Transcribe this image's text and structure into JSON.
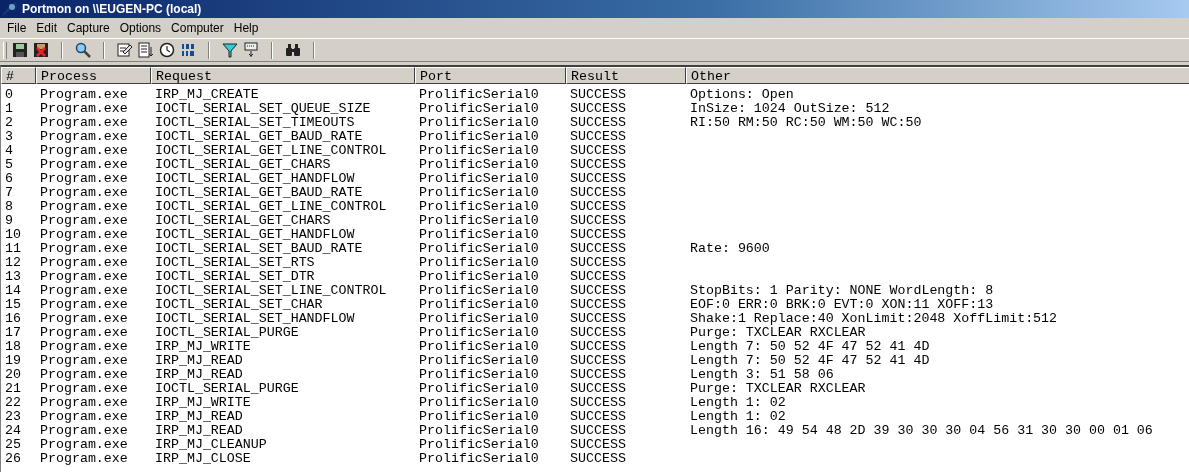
{
  "window": {
    "title": "Portmon on \\\\EUGEN-PC (local)"
  },
  "menu": [
    "File",
    "Edit",
    "Capture",
    "Options",
    "Computer",
    "Help"
  ],
  "table": {
    "columns": [
      "#",
      "Process",
      "Request",
      "Port",
      "Result",
      "Other"
    ],
    "rows": [
      {
        "num": "0",
        "process": "Program.exe",
        "request": "IRP_MJ_CREATE",
        "port": "ProlificSerial0",
        "result": "SUCCESS",
        "other": "Options: Open"
      },
      {
        "num": "1",
        "process": "Program.exe",
        "request": "IOCTL_SERIAL_SET_QUEUE_SIZE",
        "port": "ProlificSerial0",
        "result": "SUCCESS",
        "other": "InSize: 1024 OutSize: 512"
      },
      {
        "num": "2",
        "process": "Program.exe",
        "request": "IOCTL_SERIAL_SET_TIMEOUTS",
        "port": "ProlificSerial0",
        "result": "SUCCESS",
        "other": "RI:50 RM:50 RC:50 WM:50 WC:50"
      },
      {
        "num": "3",
        "process": "Program.exe",
        "request": "IOCTL_SERIAL_GET_BAUD_RATE",
        "port": "ProlificSerial0",
        "result": "SUCCESS"
      },
      {
        "num": "4",
        "process": "Program.exe",
        "request": "IOCTL_SERIAL_GET_LINE_CONTROL",
        "port": "ProlificSerial0",
        "result": "SUCCESS"
      },
      {
        "num": "5",
        "process": "Program.exe",
        "request": "IOCTL_SERIAL_GET_CHARS",
        "port": "ProlificSerial0",
        "result": "SUCCESS"
      },
      {
        "num": "6",
        "process": "Program.exe",
        "request": "IOCTL_SERIAL_GET_HANDFLOW",
        "port": "ProlificSerial0",
        "result": "SUCCESS"
      },
      {
        "num": "7",
        "process": "Program.exe",
        "request": "IOCTL_SERIAL_GET_BAUD_RATE",
        "port": "ProlificSerial0",
        "result": "SUCCESS"
      },
      {
        "num": "8",
        "process": "Program.exe",
        "request": "IOCTL_SERIAL_GET_LINE_CONTROL",
        "port": "ProlificSerial0",
        "result": "SUCCESS"
      },
      {
        "num": "9",
        "process": "Program.exe",
        "request": "IOCTL_SERIAL_GET_CHARS",
        "port": "ProlificSerial0",
        "result": "SUCCESS"
      },
      {
        "num": "10",
        "process": "Program.exe",
        "request": "IOCTL_SERIAL_GET_HANDFLOW",
        "port": "ProlificSerial0",
        "result": "SUCCESS"
      },
      {
        "num": "11",
        "process": "Program.exe",
        "request": "IOCTL_SERIAL_SET_BAUD_RATE",
        "port": "ProlificSerial0",
        "result": "SUCCESS",
        "other": "Rate: 9600"
      },
      {
        "num": "12",
        "process": "Program.exe",
        "request": "IOCTL_SERIAL_SET_RTS",
        "port": "ProlificSerial0",
        "result": "SUCCESS"
      },
      {
        "num": "13",
        "process": "Program.exe",
        "request": "IOCTL_SERIAL_SET_DTR",
        "port": "ProlificSerial0",
        "result": "SUCCESS"
      },
      {
        "num": "14",
        "process": "Program.exe",
        "request": "IOCTL_SERIAL_SET_LINE_CONTROL",
        "port": "ProlificSerial0",
        "result": "SUCCESS",
        "other": "StopBits: 1 Parity: NONE WordLength: 8"
      },
      {
        "num": "15",
        "process": "Program.exe",
        "request": "IOCTL_SERIAL_SET_CHAR",
        "port": "ProlificSerial0",
        "result": "SUCCESS",
        "other": "EOF:0 ERR:0 BRK:0 EVT:0 XON:11 XOFF:13"
      },
      {
        "num": "16",
        "process": "Program.exe",
        "request": "IOCTL_SERIAL_SET_HANDFLOW",
        "port": "ProlificSerial0",
        "result": "SUCCESS",
        "other": "Shake:1 Replace:40 XonLimit:2048 XoffLimit:512"
      },
      {
        "num": "17",
        "process": "Program.exe",
        "request": "IOCTL_SERIAL_PURGE",
        "port": "ProlificSerial0",
        "result": "SUCCESS",
        "other": "Purge: TXCLEAR RXCLEAR"
      },
      {
        "num": "18",
        "process": "Program.exe",
        "request": "IRP_MJ_WRITE",
        "port": "ProlificSerial0",
        "result": "SUCCESS",
        "other": "Length 7: 50 52 4F 47 52 41 4D"
      },
      {
        "num": "19",
        "process": "Program.exe",
        "request": "IRP_MJ_READ",
        "port": "ProlificSerial0",
        "result": "SUCCESS",
        "other": "Length 7: 50 52 4F 47 52 41 4D"
      },
      {
        "num": "20",
        "process": "Program.exe",
        "request": "IRP_MJ_READ",
        "port": "ProlificSerial0",
        "result": "SUCCESS",
        "other": "Length 3: 51 58 06"
      },
      {
        "num": "21",
        "process": "Program.exe",
        "request": "IOCTL_SERIAL_PURGE",
        "port": "ProlificSerial0",
        "result": "SUCCESS",
        "other": "Purge: TXCLEAR RXCLEAR"
      },
      {
        "num": "22",
        "process": "Program.exe",
        "request": "IRP_MJ_WRITE",
        "port": "ProlificSerial0",
        "result": "SUCCESS",
        "other": "Length 1: 02"
      },
      {
        "num": "23",
        "process": "Program.exe",
        "request": "IRP_MJ_READ",
        "port": "ProlificSerial0",
        "result": "SUCCESS",
        "other": "Length 1: 02"
      },
      {
        "num": "24",
        "process": "Program.exe",
        "request": "IRP_MJ_READ",
        "port": "ProlificSerial0",
        "result": "SUCCESS",
        "other": "Length 16: 49 54 48 2D 39 30 30 30 04 56 31 30 30 00 01 06"
      },
      {
        "num": "25",
        "process": "Program.exe",
        "request": "IRP_MJ_CLEANUP",
        "port": "ProlificSerial0",
        "result": "SUCCESS"
      },
      {
        "num": "26",
        "process": "Program.exe",
        "request": "IRP_MJ_CLOSE",
        "port": "ProlificSerial0",
        "result": "SUCCESS"
      }
    ]
  }
}
